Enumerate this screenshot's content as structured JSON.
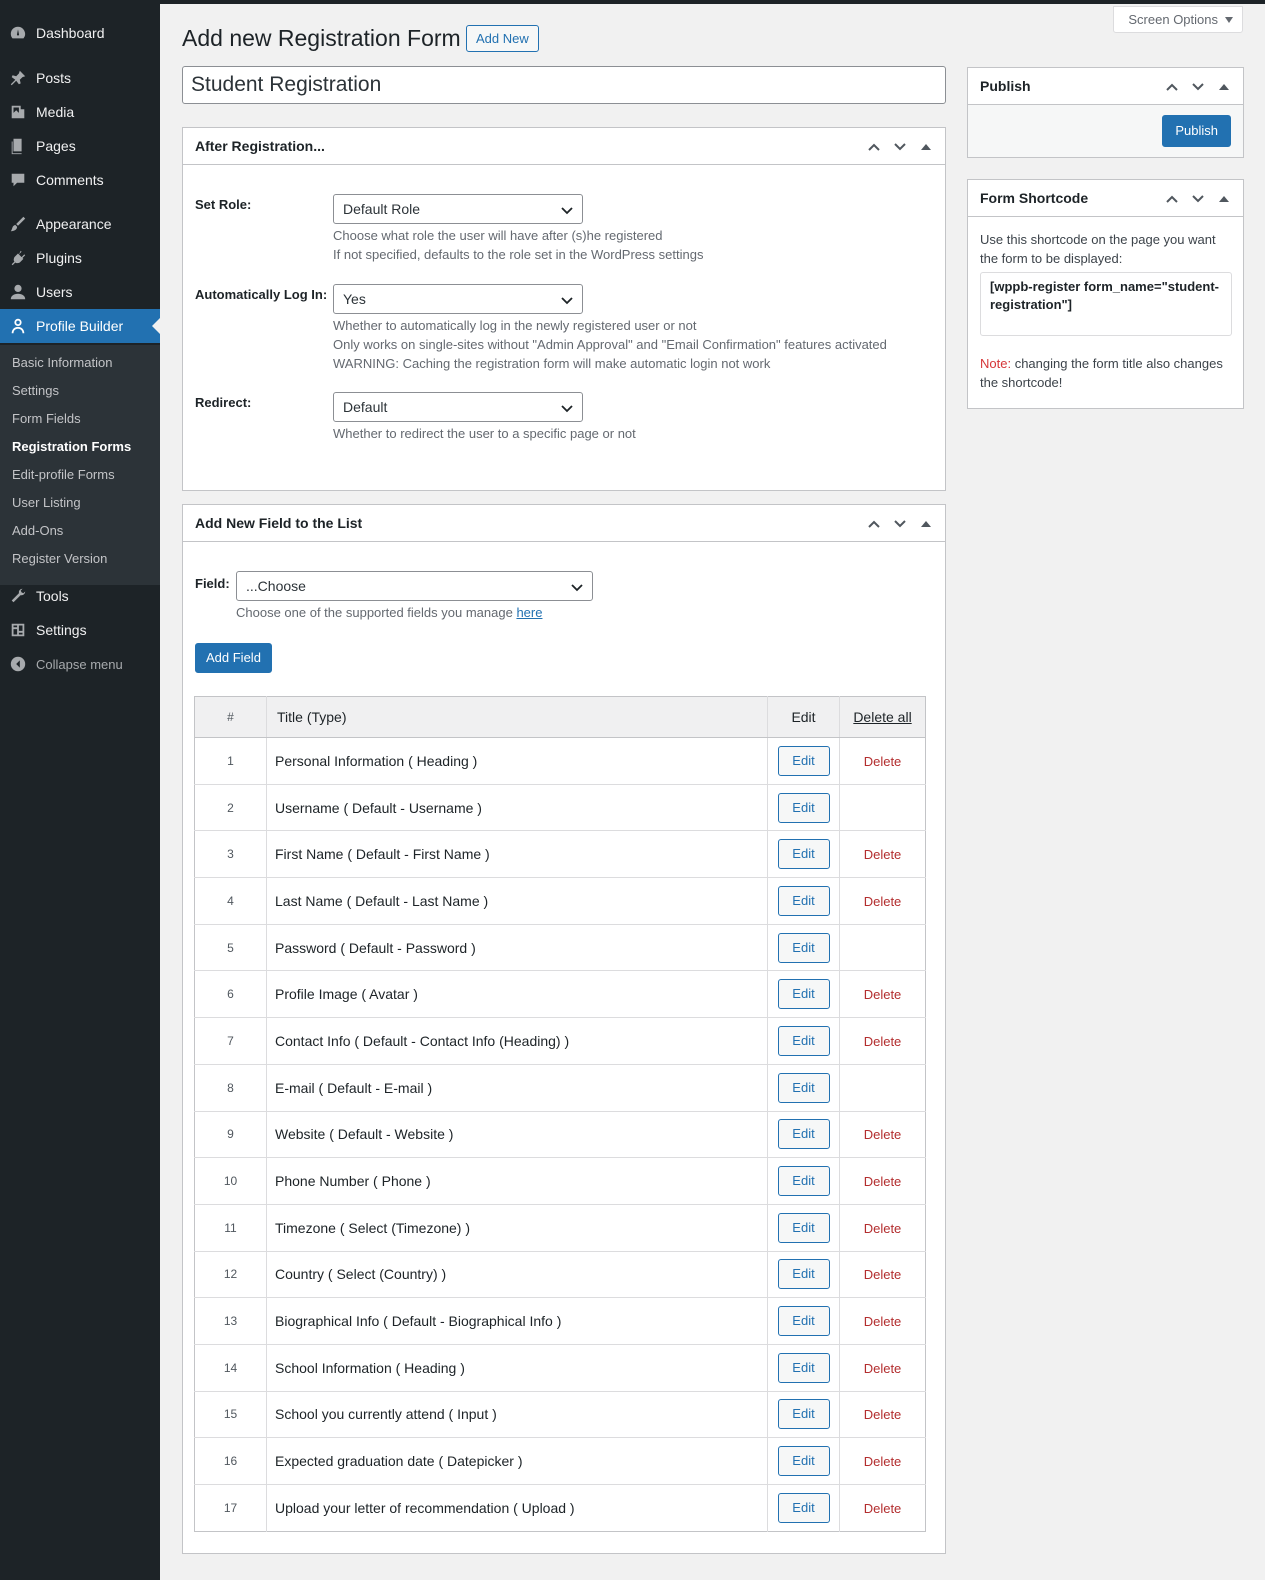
{
  "sidebar": {
    "items": [
      {
        "label": "Dashboard",
        "icon": "dashboard-icon"
      },
      {
        "label": "Posts",
        "icon": "pin-icon"
      },
      {
        "label": "Media",
        "icon": "media-icon"
      },
      {
        "label": "Pages",
        "icon": "pages-icon"
      },
      {
        "label": "Comments",
        "icon": "comment-icon"
      },
      {
        "label": "Appearance",
        "icon": "brush-icon"
      },
      {
        "label": "Plugins",
        "icon": "plug-icon"
      },
      {
        "label": "Users",
        "icon": "user-icon"
      },
      {
        "label": "Profile Builder",
        "icon": "person-outline-icon"
      }
    ],
    "submenu": [
      "Basic Information",
      "Settings",
      "Form Fields",
      "Registration Forms",
      "Edit-profile Forms",
      "User Listing",
      "Add-Ons",
      "Register Version"
    ],
    "bottom_items": [
      {
        "label": "Tools",
        "icon": "wrench-icon"
      },
      {
        "label": "Settings",
        "icon": "settings-icon"
      },
      {
        "label": "Collapse menu",
        "icon": "collapse-icon"
      }
    ]
  },
  "header": {
    "title": "Add new Registration Form",
    "add_new": "Add New",
    "screen_options": "Screen Options"
  },
  "form_title": "Student Registration",
  "after_registration": {
    "title": "After Registration...",
    "set_role_label": "Set Role:",
    "set_role_value": "Default Role",
    "set_role_desc1": "Choose what role the user will have after (s)he registered",
    "set_role_desc2": "If not specified, defaults to the role set in the WordPress settings",
    "auto_login_label": "Automatically Log In:",
    "auto_login_value": "Yes",
    "auto_login_desc1": "Whether to automatically log in the newly registered user or not",
    "auto_login_desc2": "Only works on single-sites without \"Admin Approval\" and \"Email Confirmation\" features activated",
    "auto_login_desc3": "WARNING: Caching the registration form will make automatic login not work",
    "redirect_label": "Redirect:",
    "redirect_value": "Default",
    "redirect_desc": "Whether to redirect the user to a specific page or not"
  },
  "add_field": {
    "title": "Add New Field to the List",
    "field_label": "Field:",
    "field_value": "...Choose",
    "field_desc": "Choose one of the supported fields you manage",
    "field_desc_link": "here",
    "add_button": "Add Field"
  },
  "table": {
    "headers": {
      "num": "#",
      "title": "Title (Type)",
      "edit": "Edit",
      "delete_all": "Delete all"
    },
    "edit_label": "Edit",
    "delete_label": "Delete",
    "rows": [
      {
        "num": "1",
        "title": "Personal Information ( Heading )",
        "deletable": true
      },
      {
        "num": "2",
        "title": "Username ( Default - Username )",
        "deletable": false
      },
      {
        "num": "3",
        "title": "First Name ( Default - First Name )",
        "deletable": true
      },
      {
        "num": "4",
        "title": "Last Name ( Default - Last Name )",
        "deletable": true
      },
      {
        "num": "5",
        "title": "Password ( Default - Password )",
        "deletable": false
      },
      {
        "num": "6",
        "title": "Profile Image ( Avatar )",
        "deletable": true
      },
      {
        "num": "7",
        "title": "Contact Info ( Default - Contact Info (Heading) )",
        "deletable": true
      },
      {
        "num": "8",
        "title": "E-mail ( Default - E-mail )",
        "deletable": false
      },
      {
        "num": "9",
        "title": "Website ( Default - Website )",
        "deletable": true
      },
      {
        "num": "10",
        "title": "Phone Number ( Phone )",
        "deletable": true
      },
      {
        "num": "11",
        "title": "Timezone ( Select (Timezone) )",
        "deletable": true
      },
      {
        "num": "12",
        "title": "Country ( Select (Country) )",
        "deletable": true
      },
      {
        "num": "13",
        "title": "Biographical Info ( Default - Biographical Info )",
        "deletable": true
      },
      {
        "num": "14",
        "title": "School Information ( Heading )",
        "deletable": true
      },
      {
        "num": "15",
        "title": "School you currently attend ( Input )",
        "deletable": true
      },
      {
        "num": "16",
        "title": "Expected graduation date ( Datepicker )",
        "deletable": true
      },
      {
        "num": "17",
        "title": "Upload your letter of recommendation ( Upload )",
        "deletable": true
      }
    ]
  },
  "publish": {
    "title": "Publish",
    "button": "Publish"
  },
  "shortcode": {
    "title": "Form Shortcode",
    "desc": "Use this shortcode on the page you want the form to be displayed:",
    "code": "[wppb-register form_name=\"student-registration\"]",
    "note_label": "Note:",
    "note_text": " changing the form title also changes the shortcode!"
  },
  "colors": {
    "sidebar_bg": "#1d2327",
    "accent": "#2271b1",
    "delete": "#b32d2e"
  }
}
